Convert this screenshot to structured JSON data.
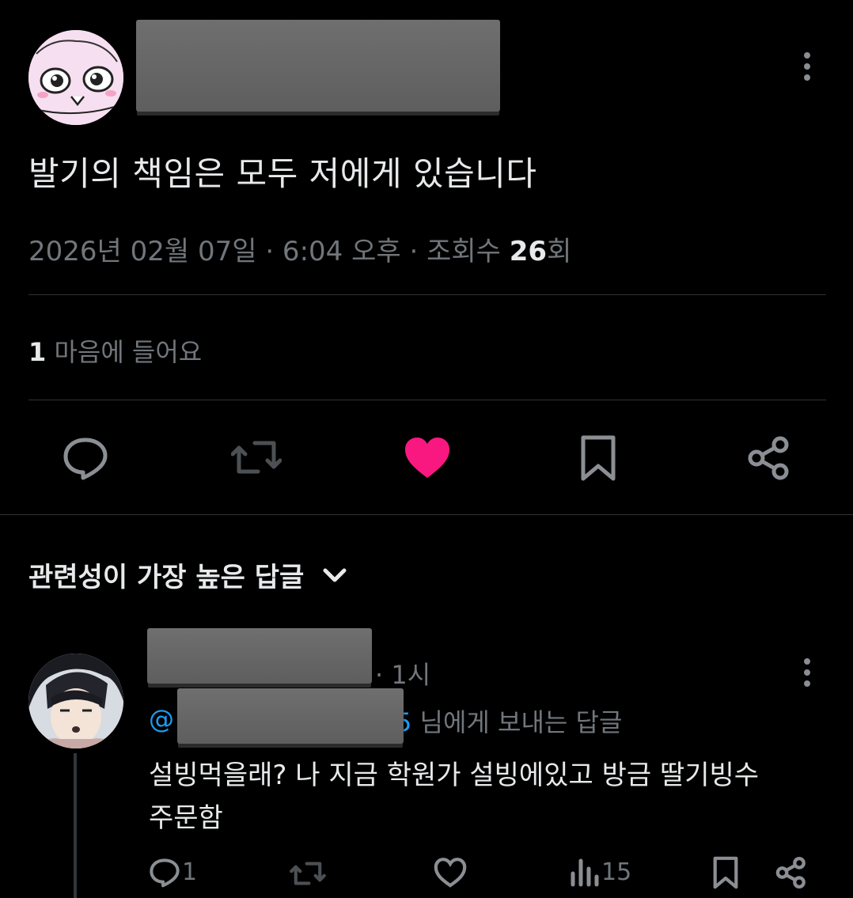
{
  "post": {
    "text": "발기의 책임은 모두 저에게 있습니다",
    "meta_prefix": "2026년 02월 07일 · 6:04 오후 · 조회수 ",
    "views": "26",
    "views_suffix": "회",
    "likes_count": "1",
    "likes_label": "마음에 들어요",
    "accent_like": "#f91880"
  },
  "replies_sort": {
    "label": "관련성이 가장 높은 답글"
  },
  "reply": {
    "time": "· 1시",
    "mention_at": "@",
    "mention_tail": "님에게 보내는 답글",
    "text_line1": "설빙먹을래? 나 지금 학원가 설빙에있고 방금 딸기빙수",
    "text_line2": "주문함",
    "reply_count": "1",
    "views_count": "15",
    "mention_color": "#1d9bf0"
  },
  "icons": [
    "more-icon",
    "reply-icon",
    "repost-icon",
    "like-icon",
    "bookmark-icon",
    "share-icon",
    "views-icon",
    "chevron-down-icon"
  ]
}
